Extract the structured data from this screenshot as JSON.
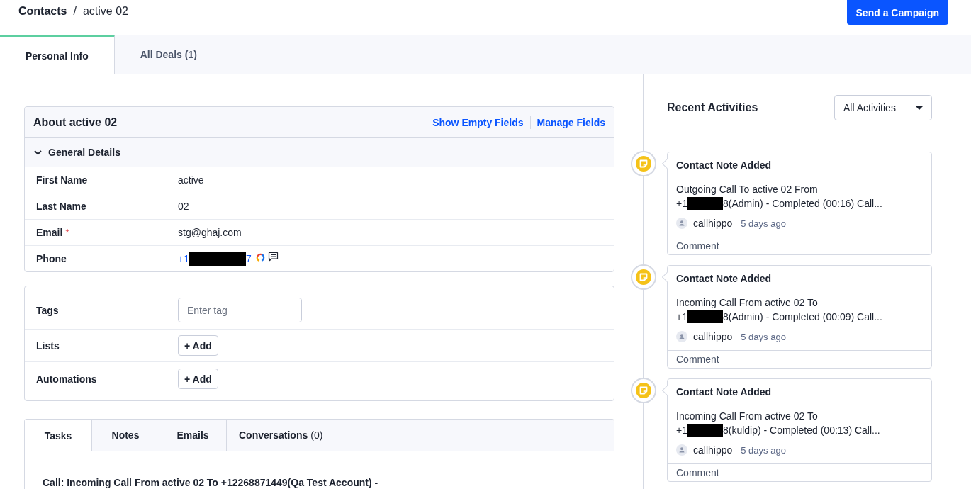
{
  "breadcrumb": {
    "separator": "/",
    "items": [
      {
        "label": "Contacts",
        "current": false
      },
      {
        "label": "active 02",
        "current": true
      }
    ]
  },
  "header_button": {
    "label": "Send a Campaign"
  },
  "tabs": [
    {
      "label": "Personal Info",
      "selected": true
    },
    {
      "label": "All Deals (1)",
      "selected": false
    }
  ],
  "about": {
    "title": "About active 02",
    "links": [
      "Show Empty Fields",
      "Manage Fields"
    ],
    "section": {
      "label": "General Details",
      "expanded": true
    },
    "fields": [
      {
        "kind": "text",
        "label": "First Name",
        "value": "active"
      },
      {
        "kind": "text",
        "label": "Last Name",
        "value": "02"
      },
      {
        "kind": "text",
        "label": "Email",
        "required_mark": "*",
        "value": "stg@ghaj.com"
      },
      {
        "kind": "phone",
        "label": "Phone",
        "value_before_redaction": "+1",
        "value_after_redaction": "7"
      }
    ]
  },
  "tags_card": {
    "rows": [
      {
        "kind": "input",
        "label": "Tags",
        "placeholder": "Enter tag"
      },
      {
        "kind": "add",
        "label": "Lists",
        "button": "+ Add"
      },
      {
        "kind": "add",
        "label": "Automations",
        "button": "+ Add"
      }
    ]
  },
  "activity_tabs": {
    "tabs": [
      {
        "label": "Tasks",
        "selected": true
      },
      {
        "label": "Notes",
        "selected": false
      },
      {
        "label": "Emails",
        "selected": false
      },
      {
        "label": "Conversations",
        "count": "(0)",
        "selected": false
      }
    ],
    "tasks": [
      {
        "text": "Call: Incoming Call From active 02 To +12268871449(Qa Test Account) -",
        "done": true
      }
    ]
  },
  "recent_activities": {
    "title": "Recent Activities",
    "filter": "All Activities",
    "items": [
      {
        "title": "Contact Note Added",
        "description_line_1": "Outgoing Call To active 02 From",
        "description_line_2_start": "+1",
        "description_line_2_end": "8(Admin) - Completed (00:16) Call...",
        "author": "callhippo",
        "time": "5 days ago",
        "comment": "Comment"
      },
      {
        "title": "Contact Note Added",
        "description_line_1": "Incoming Call From active 02 To",
        "description_line_2_start": "+1",
        "description_line_2_end": "8(Admin) - Completed (00:09) Call...",
        "author": "callhippo",
        "time": "5 days ago",
        "comment": "Comment"
      },
      {
        "title": "Contact Note Added",
        "description_line_1": "Incoming Call From active 02 To",
        "description_line_2_start": "+1",
        "description_line_2_end": "8(kuldip) - Completed (00:13) Call...",
        "author": "callhippo",
        "time": "5 days ago",
        "comment": "Comment"
      }
    ]
  }
}
